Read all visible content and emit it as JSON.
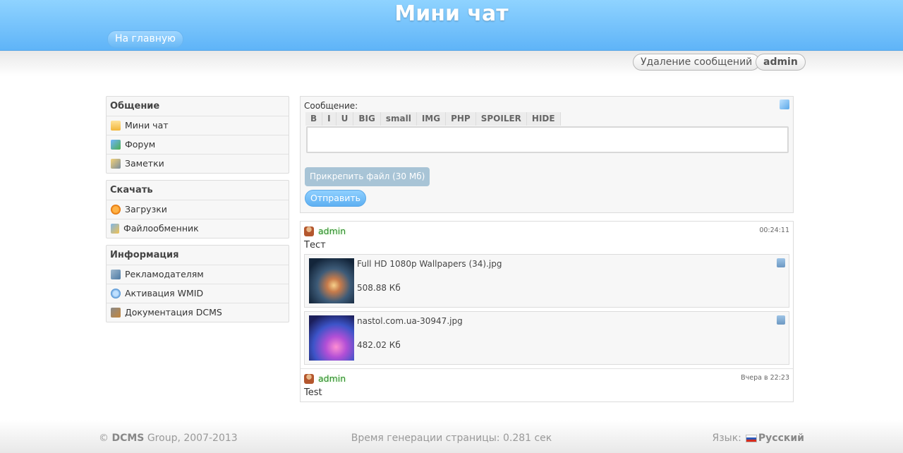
{
  "header": {
    "title": "Мини чат",
    "home_label": "На главную",
    "delete_messages_label": "Удаление сообщений",
    "user_label": "admin"
  },
  "sidebar": {
    "sections": [
      {
        "title": "Общение",
        "items": [
          {
            "label": "Мини чат",
            "icon": "chat-window-icon"
          },
          {
            "label": "Форум",
            "icon": "forum-icon"
          },
          {
            "label": "Заметки",
            "icon": "pencil-icon"
          }
        ]
      },
      {
        "title": "Скачать",
        "items": [
          {
            "label": "Загрузки",
            "icon": "download-icon"
          },
          {
            "label": "Файлообменник",
            "icon": "file-exchange-icon"
          }
        ]
      },
      {
        "title": "Информация",
        "items": [
          {
            "label": "Рекламодателям",
            "icon": "advertisers-icon"
          },
          {
            "label": "Активация WMID",
            "icon": "dollar-coin-icon"
          },
          {
            "label": "Документация DCMS",
            "icon": "hammer-icon"
          }
        ]
      }
    ]
  },
  "form": {
    "label": "Сообщение:",
    "bbcodes": [
      "B",
      "I",
      "U",
      "BIG",
      "small",
      "IMG",
      "PHP",
      "SPOILER",
      "HIDE"
    ],
    "textarea_value": "",
    "attach_label": "Прикрепить файл (30 Мб)",
    "send_label": "Отправить"
  },
  "messages": [
    {
      "user": "admin",
      "time": "00:24:11",
      "text": "Тест",
      "files": [
        {
          "name": "Full HD 1080p Wallpapers (34).jpg",
          "size": "508.88 Кб"
        },
        {
          "name": "nastol.com.ua-30947.jpg",
          "size": "482.02 Кб"
        }
      ]
    },
    {
      "user": "admin",
      "time": "Вчера в 22:23",
      "text": "Test",
      "files": []
    }
  ],
  "footer": {
    "copyright_symbol": "©",
    "copyright_brand": "DCMS",
    "copyright_rest": "Group, 2007-2013",
    "generation": "Время генерации страницы: 0.281 сек",
    "language_label": "Язык:",
    "language_value": "Русский"
  },
  "colors": {
    "header_top": "#8fd3ff",
    "header_bottom": "#5fb4f8",
    "username": "#2a8a2a",
    "attach_button": "#a8c4d6"
  }
}
